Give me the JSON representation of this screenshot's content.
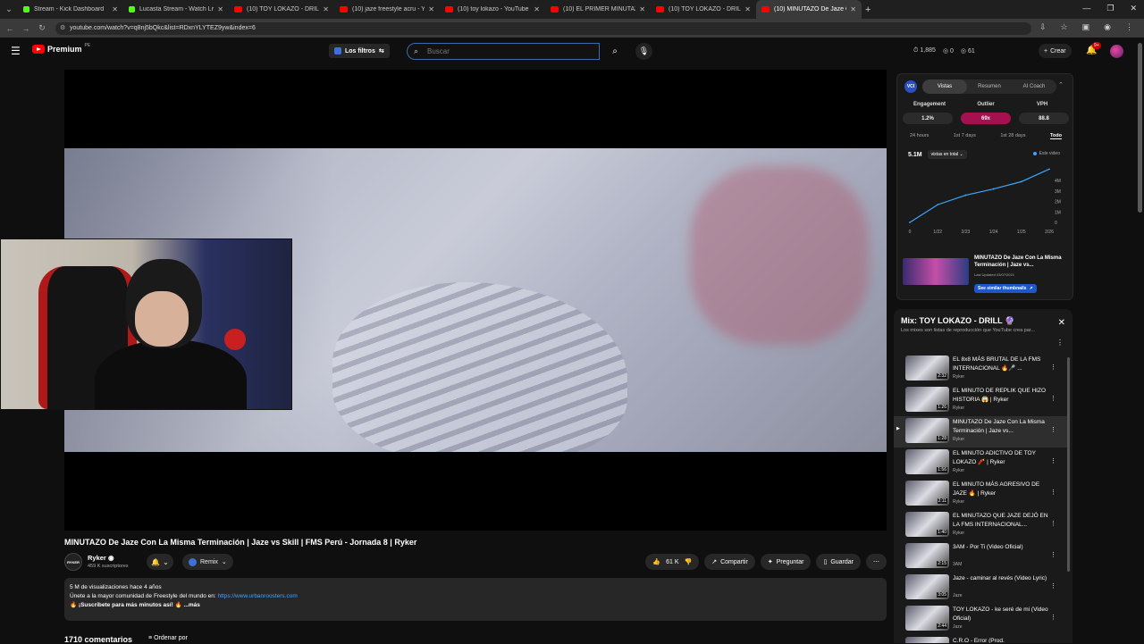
{
  "browser": {
    "tabs": [
      {
        "label": "Stream - Kick Dashboard",
        "favicon": "kick-icon",
        "active": false
      },
      {
        "label": "Lucasta Stream - Watch Live on",
        "favicon": "kick-icon",
        "active": false
      },
      {
        "label": "(10) TOY LOKAZO - DRILL",
        "favicon": "youtube-icon",
        "active": false
      },
      {
        "label": "(10) jaze freestyle acru - YouTu",
        "favicon": "youtube-icon",
        "active": false
      },
      {
        "label": "(10) toy lokazo - YouTube",
        "favicon": "youtube-icon",
        "active": false
      },
      {
        "label": "(10) EL PRIMER MINUTAZO DE",
        "favicon": "youtube-icon",
        "active": false
      },
      {
        "label": "(10) TOY LOKAZO - DRILL",
        "favicon": "youtube-icon",
        "active": false
      },
      {
        "label": "(10) MINUTAZO De Jaze Con La",
        "favicon": "youtube-icon",
        "active": true
      }
    ],
    "url": "youtube.com/watch?v=q8nj5bQkc&list=RDxnYLYTEZ9yw&index=6"
  },
  "masthead": {
    "logo": "Premium",
    "logo_sup": "PE",
    "filters_label": "Los filtros",
    "search_placeholder": "Buscar",
    "stats": [
      "1,885",
      "0",
      "61"
    ],
    "create_label": "Crear",
    "notifications_badge": "9+"
  },
  "video": {
    "title": "MINUTAZO De Jaze Con La Misma Terminación | Jaze vs Skill | FMS Perú - Jornada 8 | Ryker",
    "channel": "Ryker",
    "channel_avatar_text": "RYKER",
    "subscribers": "459 K suscriptores",
    "remix_label": "Remix",
    "likes": "61 K",
    "share_label": "Compartir",
    "ask_label": "Preguntar",
    "save_label": "Guardar",
    "description_line1": "5 M de visualizaciones  hace 4 años",
    "description_line2": "Únete a la mayor comunidad de Freestyle del mundo en:",
    "description_link": "https://www.urbanroosters.com",
    "description_line3": "🔥 ¡Suscríbete para más minutos así! 🔥 ...más",
    "comments_count": "1710 comentarios",
    "sort_label": "Ordenar por"
  },
  "extension": {
    "logo": "VCI",
    "tabs": [
      "Vistas",
      "Resumen",
      "AI Coach"
    ],
    "metrics": [
      {
        "label": "Engagement",
        "value": "1.2%",
        "highlight": false
      },
      {
        "label": "Outlier",
        "value": "69x",
        "highlight": true
      },
      {
        "label": "VPH",
        "value": "88.8",
        "highlight": false
      }
    ],
    "ranges": [
      "24 hours",
      "1st 7 days",
      "1st 28 days",
      "Todo"
    ],
    "active_range": "Todo",
    "total_views": "5.1M",
    "views_dropdown": "vistas en total",
    "legend": "Este video",
    "mini_title": "MINUTAZO De Jaze Con La Misma Terminación | Jaze vs...",
    "mini_date": "Last Updated 03/07/2021",
    "similar_label": "See similar thumbnails"
  },
  "chart_data": {
    "type": "line",
    "categories": [
      "0",
      "1/22",
      "2/23",
      "1/24",
      "1/25",
      "2/26"
    ],
    "series": [
      {
        "values": [
          0.0,
          1.7,
          2.6,
          3.2,
          3.9,
          5.1
        ]
      }
    ],
    "y_ticks": [
      "0",
      "1M",
      "2M",
      "3M",
      "4M"
    ],
    "y_tick_values": [
      0,
      1,
      2,
      3,
      4
    ],
    "ylim": [
      0,
      5.3
    ],
    "color": "#3ea6ff"
  },
  "playlist": {
    "title": "Mix: TOY LOKAZO - DRILL 🔮",
    "subtitle": "Los mixes son listas de reproducción que YouTube crea par...",
    "items": [
      {
        "title": "EL 8x8 MÁS BRUTAL DE LA FMS INTERNACIONAL 🔥🎤 ...",
        "channel": "Ryker",
        "duration": "2:32"
      },
      {
        "title": "EL MINUTO DE REPLIK QUE HIZO HISTORIA 😱 | Ryker",
        "channel": "Ryker",
        "duration": "1:26"
      },
      {
        "title": "MINUTAZO De Jaze Con La Misma Terminación | Jaze vs...",
        "channel": "Ryker",
        "duration": "1:28",
        "current": true
      },
      {
        "title": "EL MINUTO ADICTIVO DE TOY LOKAZO 🧨 | Ryker",
        "channel": "Ryker",
        "duration": "1:56"
      },
      {
        "title": "EL MINUTO MÁS AGRESIVO DE JAZE 🔥 | Ryker",
        "channel": "Ryker",
        "duration": "2:11"
      },
      {
        "title": "EL MINUTAZO QUE JAZE DEJÓ EN LA FMS INTERNACIONAL...",
        "channel": "Ryker",
        "duration": "1:40"
      },
      {
        "title": "3AM - Por Ti (Video Oficial)",
        "channel": "3AM",
        "duration": "2:15"
      },
      {
        "title": "Jaze - caminar al revés (Video Lyric)",
        "channel": "Jaze",
        "duration": "3:05"
      },
      {
        "title": "TOY LOKAZO - ke seré de mi (Video Oficial)",
        "channel": "Jaze",
        "duration": "2:44"
      },
      {
        "title": "C.R.O - Error (Prod.",
        "channel": "",
        "duration": ""
      }
    ]
  }
}
